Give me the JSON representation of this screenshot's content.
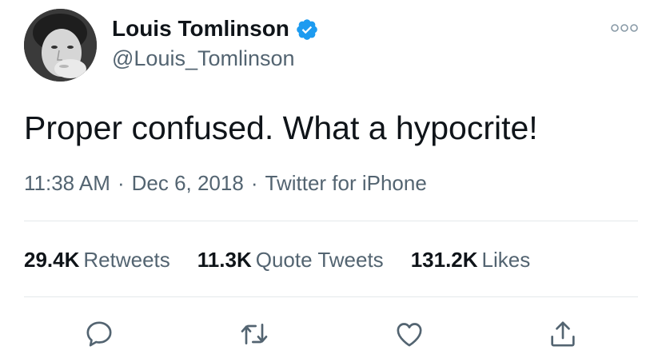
{
  "user": {
    "display_name": "Louis Tomlinson",
    "handle": "@Louis_Tomlinson",
    "verified": true
  },
  "tweet": {
    "text": "Proper confused. What a hypocrite!",
    "time": "11:38 AM",
    "date": "Dec 6, 2018",
    "source": "Twitter for iPhone",
    "separator": "·"
  },
  "stats": {
    "retweets": {
      "count": "29.4K",
      "label": "Retweets"
    },
    "quote_tweets": {
      "count": "11.3K",
      "label": "Quote Tweets"
    },
    "likes": {
      "count": "131.2K",
      "label": "Likes"
    }
  },
  "icons": {
    "verified": "verified-badge-icon",
    "more": "more-options-icon",
    "reply": "reply-icon",
    "retweet": "retweet-icon",
    "like": "heart-icon",
    "share": "share-icon"
  },
  "colors": {
    "verified_blue": "#1d9bf0",
    "secondary_text": "#536471",
    "primary_text": "#0f1419",
    "divider": "#e4e8eb"
  }
}
